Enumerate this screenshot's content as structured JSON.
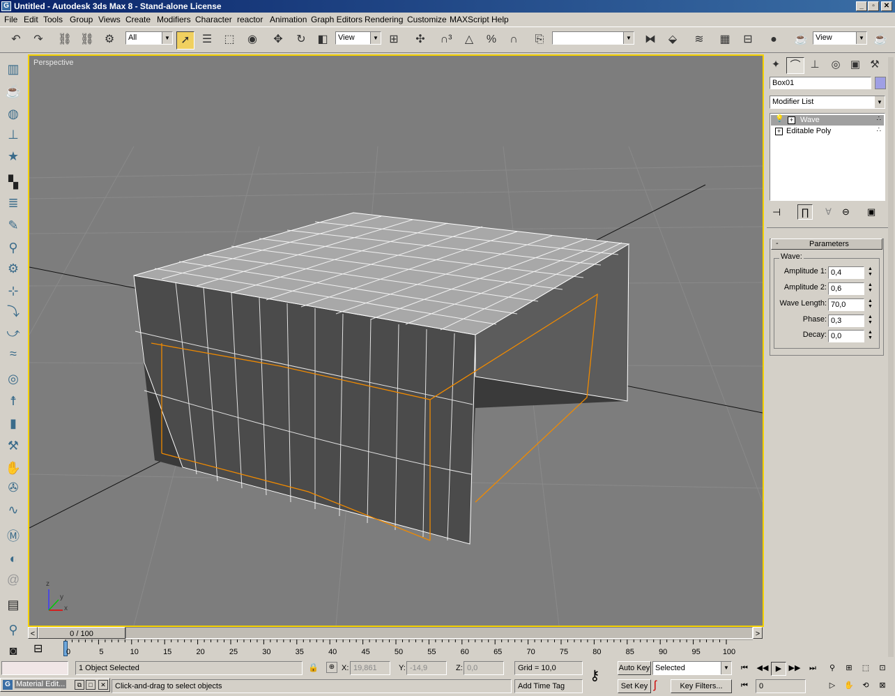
{
  "window": {
    "title": "Untitled - Autodesk 3ds Max 8 - Stand-alone License",
    "app_icon": "3ds-max-icon"
  },
  "menu": [
    "File",
    "Edit",
    "Tools",
    "Group",
    "Views",
    "Create",
    "Modifiers",
    "Character",
    "reactor",
    "Animation",
    "Graph Editors",
    "Rendering",
    "Customize",
    "MAXScript",
    "Help"
  ],
  "toolbar": {
    "selection_filter": "All",
    "ref_coord_system": "View",
    "named_selection_set": "",
    "render_view": "View"
  },
  "viewport": {
    "label": "Perspective",
    "axis_x": "x",
    "axis_y": "y",
    "axis_z": "z"
  },
  "command_panel": {
    "object_name": "Box01",
    "object_color": "#9f9fe4",
    "modifier_list_label": "Modifier List",
    "stack": [
      {
        "name": "Wave",
        "selected": true
      },
      {
        "name": "Editable Poly",
        "selected": false
      }
    ],
    "rollout_title": "Parameters",
    "rollout_toggle": "-",
    "group_label": "Wave:",
    "params": [
      {
        "label": "Amplitude 1:",
        "value": "0,4"
      },
      {
        "label": "Amplitude 2:",
        "value": "0,6"
      },
      {
        "label": "Wave Length:",
        "value": "70,0"
      },
      {
        "label": "Phase:",
        "value": "0,3"
      },
      {
        "label": "Decay:",
        "value": "0,0"
      }
    ]
  },
  "time_slider": {
    "position": "0 / 100",
    "prev": "<",
    "next": ">",
    "ticks": [
      "0",
      "5",
      "10",
      "15",
      "20",
      "25",
      "30",
      "35",
      "40",
      "45",
      "50",
      "55",
      "60",
      "65",
      "70",
      "75",
      "80",
      "85",
      "90",
      "95",
      "100"
    ]
  },
  "status": {
    "selection": "1 Object Selected",
    "prompt": "Click-and-drag to select objects",
    "x_label": "X:",
    "x_value": "19,861",
    "y_label": "Y:",
    "y_value": "-14,9",
    "z_label": "Z:",
    "z_value": "0,0",
    "grid": "Grid = 10,0",
    "add_time_tag": "Add Time Tag",
    "auto_key": "Auto Key",
    "set_key": "Set Key",
    "key_mode": "Selected",
    "key_filters": "Key Filters...",
    "current_frame": "0"
  },
  "taskbar": {
    "material_editor": "Material Edit..."
  }
}
